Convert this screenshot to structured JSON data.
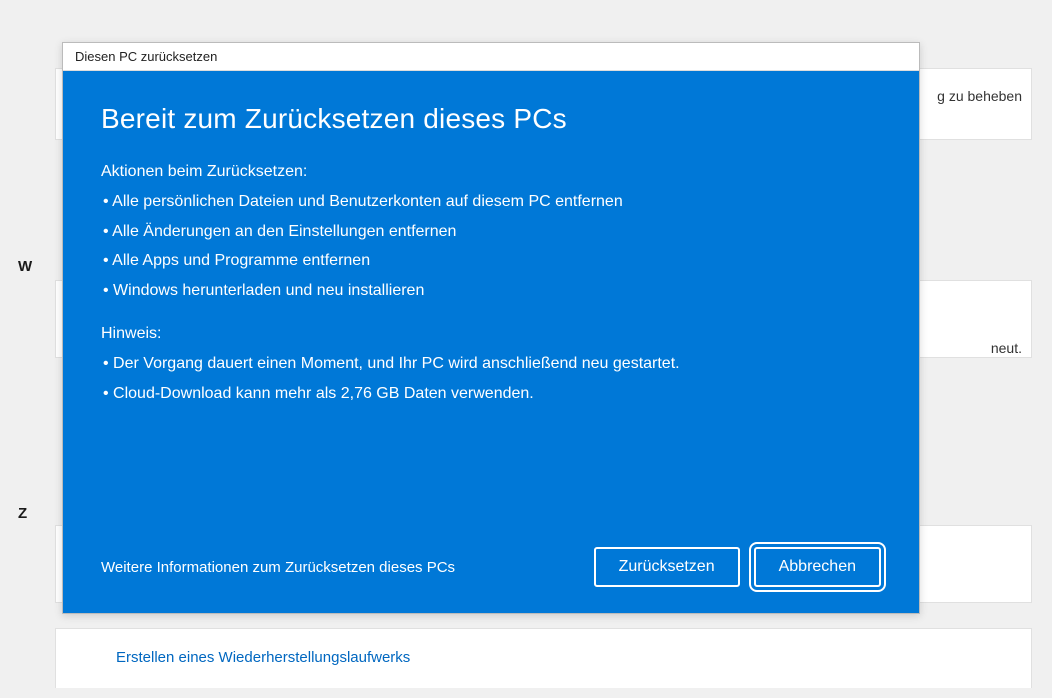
{
  "background": {
    "partial_text_1": "g zu beheben",
    "partial_text_2": "neut.",
    "label_left_1": "W",
    "label_left_2": "Z",
    "bottom_link": "Erstellen eines Wiederherstellungslaufwerks"
  },
  "dialog": {
    "title": "Diesen PC zurücksetzen",
    "heading": "Bereit zum Zurücksetzen dieses PCs",
    "actions_label": "Aktionen beim Zurücksetzen:",
    "actions": [
      "Alle persönlichen Dateien und Benutzerkonten auf diesem PC entfernen",
      "Alle Änderungen an den Einstellungen entfernen",
      "Alle Apps und Programme entfernen",
      " Windows herunterladen und neu installieren"
    ],
    "note_label": "Hinweis:",
    "notes": [
      " Der Vorgang dauert einen Moment, und Ihr PC wird anschließend neu gestartet.",
      " Cloud-Download kann mehr als 2,76 GB Daten verwenden."
    ],
    "more_info": "Weitere Informationen zum Zurücksetzen dieses PCs",
    "reset_button": "Zurücksetzen",
    "cancel_button": "Abbrechen"
  }
}
